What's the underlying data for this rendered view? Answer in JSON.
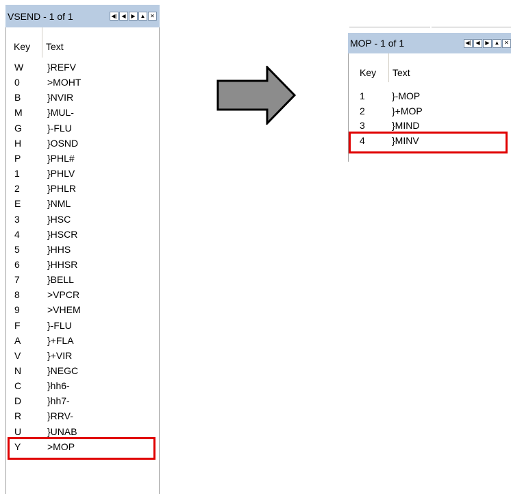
{
  "left_window": {
    "title": "VSEND  - 1 of 1",
    "nav_buttons": [
      {
        "icon": "first-page-icon",
        "glyph": "◀|"
      },
      {
        "icon": "previous-icon",
        "glyph": "◀"
      },
      {
        "icon": "next-icon",
        "glyph": "▶"
      },
      {
        "icon": "up-icon",
        "glyph": "▲"
      },
      {
        "icon": "close-icon",
        "glyph": "✕"
      }
    ],
    "headers": {
      "key": "Key",
      "text": "Text"
    },
    "rows": [
      {
        "key": "W",
        "text": "}REFV"
      },
      {
        "key": "0",
        "text": ">MOHT"
      },
      {
        "key": "B",
        "text": "}NVIR"
      },
      {
        "key": "M",
        "text": "}MUL-"
      },
      {
        "key": "G",
        "text": "}-FLU"
      },
      {
        "key": "H",
        "text": "}OSND"
      },
      {
        "key": "P",
        "text": "}PHL#"
      },
      {
        "key": "1",
        "text": "}PHLV"
      },
      {
        "key": "2",
        "text": "}PHLR"
      },
      {
        "key": "E",
        "text": "}NML"
      },
      {
        "key": "3",
        "text": "}HSC"
      },
      {
        "key": "4",
        "text": "}HSCR"
      },
      {
        "key": "5",
        "text": "}HHS"
      },
      {
        "key": "6",
        "text": "}HHSR"
      },
      {
        "key": "7",
        "text": "}BELL"
      },
      {
        "key": "8",
        "text": ">VPCR"
      },
      {
        "key": "9",
        "text": ">VHEM"
      },
      {
        "key": "F",
        "text": "}-FLU"
      },
      {
        "key": "A",
        "text": "}+FLA"
      },
      {
        "key": "V",
        "text": "}+VIR"
      },
      {
        "key": "N",
        "text": "}NEGC"
      },
      {
        "key": "C",
        "text": "}hh6-"
      },
      {
        "key": "D",
        "text": "}hh7-"
      },
      {
        "key": "R",
        "text": "}RRV-"
      },
      {
        "key": "U",
        "text": "}UNAB"
      },
      {
        "key": "Y",
        "text": ">MOP"
      }
    ],
    "highlighted_row": 25
  },
  "right_window": {
    "title": "MOP  - 1 of 1",
    "nav_buttons": [
      {
        "icon": "first-page-icon",
        "glyph": "◀|"
      },
      {
        "icon": "previous-icon",
        "glyph": "◀"
      },
      {
        "icon": "next-icon",
        "glyph": "▶"
      },
      {
        "icon": "up-icon",
        "glyph": "▲"
      },
      {
        "icon": "close-icon",
        "glyph": "✕"
      }
    ],
    "headers": {
      "key": "Key",
      "text": "Text"
    },
    "rows": [
      {
        "key": "1",
        "text": "}-MOP"
      },
      {
        "key": "2",
        "text": "}+MOP"
      },
      {
        "key": "3",
        "text": "}MIND"
      },
      {
        "key": "4",
        "text": "}MINV"
      }
    ],
    "highlighted_row": 3
  },
  "arrow": {
    "icon": "right-arrow-icon",
    "fill": "#8c8c8c",
    "stroke": "#000000"
  },
  "colors": {
    "titlebar": "#b9cce2",
    "highlight": "#e00000"
  }
}
